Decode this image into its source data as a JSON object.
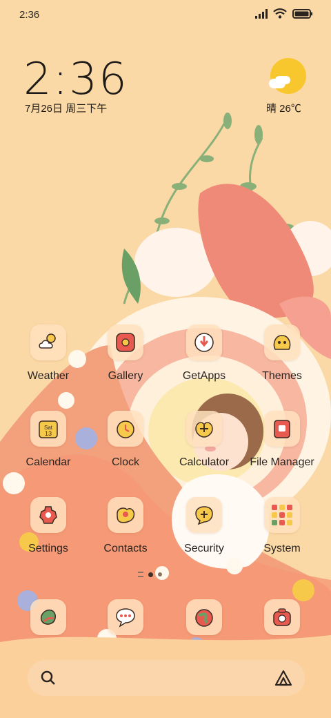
{
  "status_bar": {
    "time": "2:36"
  },
  "clock_widget": {
    "time": "2:36",
    "date": "7月26日 周三下午"
  },
  "weather_widget": {
    "text": "晴 26℃"
  },
  "apps_row1": [
    {
      "label": "Weather",
      "icon": "weather-icon"
    },
    {
      "label": "Gallery",
      "icon": "gallery-icon"
    },
    {
      "label": "GetApps",
      "icon": "getapps-icon"
    },
    {
      "label": "Themes",
      "icon": "themes-icon"
    }
  ],
  "apps_row2": [
    {
      "label": "Calendar",
      "icon": "calendar-icon",
      "cal_day": "Sat",
      "cal_date": "13"
    },
    {
      "label": "Clock",
      "icon": "clock-icon"
    },
    {
      "label": "Calculator",
      "icon": "calculator-icon"
    },
    {
      "label": "File Manager",
      "icon": "file-manager-icon"
    }
  ],
  "apps_row3": [
    {
      "label": "Settings",
      "icon": "settings-icon"
    },
    {
      "label": "Contacts",
      "icon": "contacts-icon"
    },
    {
      "label": "Security",
      "icon": "security-icon"
    },
    {
      "label": "System",
      "icon": "system-folder-icon"
    }
  ],
  "dock": [
    {
      "icon": "phone-icon"
    },
    {
      "icon": "messages-icon"
    },
    {
      "icon": "browser-icon"
    },
    {
      "icon": "camera-icon"
    }
  ],
  "colors": {
    "background": "#fbd9a6",
    "accent": "#e85a50",
    "icon_tile": "#ffe1be"
  }
}
